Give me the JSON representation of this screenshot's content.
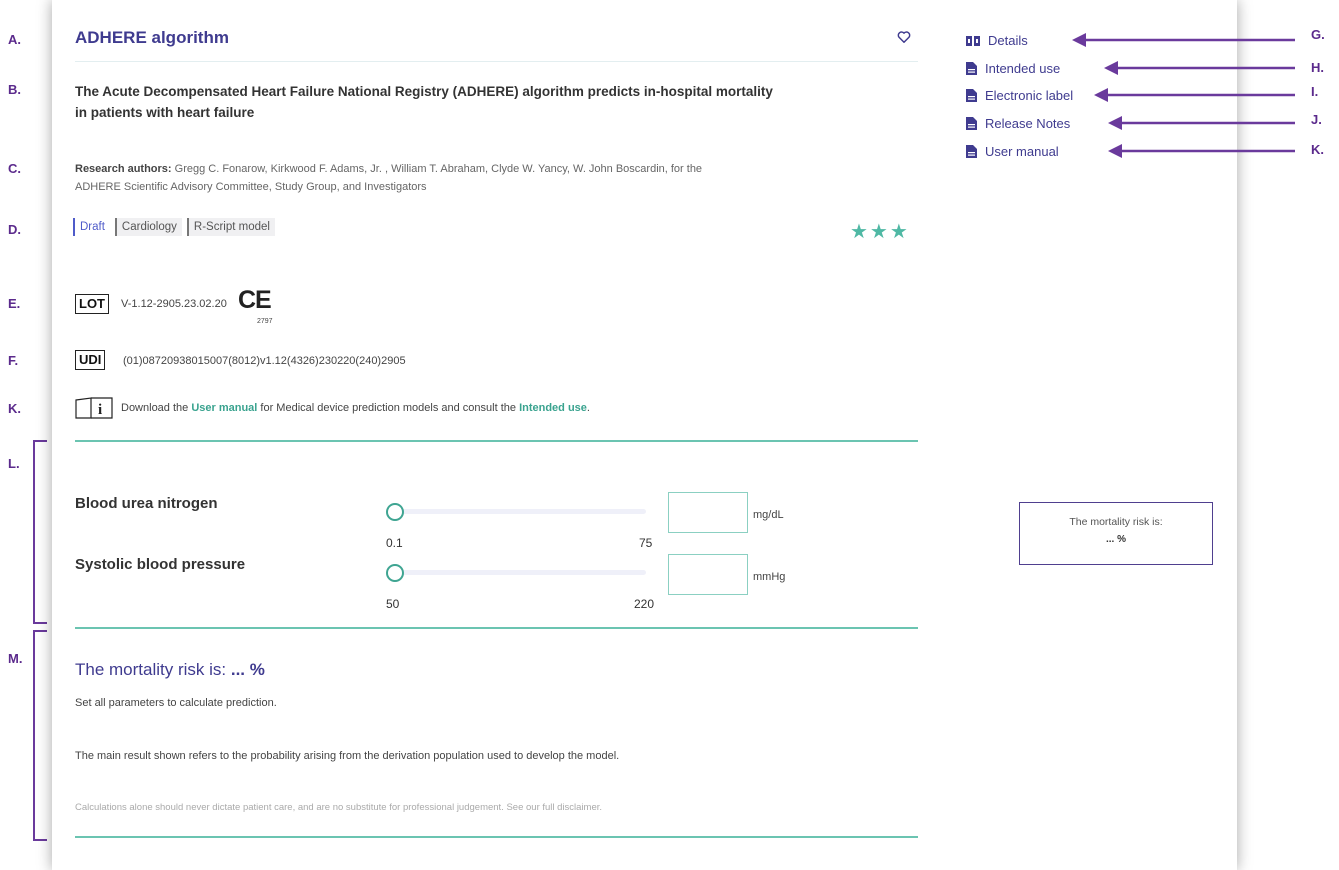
{
  "letters": {
    "left": [
      "A.",
      "B.",
      "C.",
      "D.",
      "E.",
      "F.",
      "K.",
      "L.",
      "M."
    ],
    "right": [
      "G.",
      "H.",
      "I.",
      "J.",
      "K."
    ]
  },
  "model": {
    "title": "ADHERE algorithm",
    "description": "The Acute Decompensated Heart Failure National Registry (ADHERE) algorithm predicts in-hospital mortality in patients with heart failure",
    "authors_label": "Research authors:",
    "authors": "Gregg C. Fonarow, Kirkwood F. Adams, Jr. , William T. Abraham, Clyde W. Yancy, W. John Boscardin, for the ADHERE Scientific Advisory Committee, Study Group, and Investigators",
    "tags": [
      "Draft",
      "Cardiology",
      "R-Script model"
    ],
    "rating": 3,
    "stars": "★★★"
  },
  "labels": {
    "lot_symbol": "LOT",
    "lot_value": "V-1.12-2905.23.02.20",
    "ce_mark": "CE",
    "ce_number": "2797",
    "udi_symbol": "UDI",
    "udi_value": "(01)08720938015007(8012)v1.12(4326)230220(240)2905",
    "download_prefix": "Download the ",
    "download_link1": "User manual",
    "download_mid": " for Medical device prediction models and consult the ",
    "download_link2": "Intended use",
    "download_suffix": "."
  },
  "sidebar": {
    "links": [
      "Details",
      "Intended use",
      "Electronic label",
      "Release Notes",
      "User manual"
    ]
  },
  "parameters": [
    {
      "name": "Blood urea nitrogen",
      "min": "0.1",
      "max": "75",
      "unit": "mg/dL",
      "value": ""
    },
    {
      "name": "Systolic blood pressure",
      "min": "50",
      "max": "220",
      "unit": "mmHg",
      "value": ""
    }
  ],
  "result_box": {
    "title": "The mortality risk is:",
    "value": "... %"
  },
  "result": {
    "title_prefix": "The mortality risk is: ",
    "title_value": "... %",
    "instruction": "Set all parameters to calculate prediction.",
    "note": "The main result shown refers to the probability arising from the derivation population used to develop the model.",
    "disclaimer": "Calculations alone should never dictate patient care, and are no substitute for professional judgement. See our full disclaimer."
  },
  "colors": {
    "accent_purple": "#3f3b8f",
    "annotation_purple": "#6a3a9c",
    "teal": "#3fa592",
    "star": "#4fb8a4"
  }
}
